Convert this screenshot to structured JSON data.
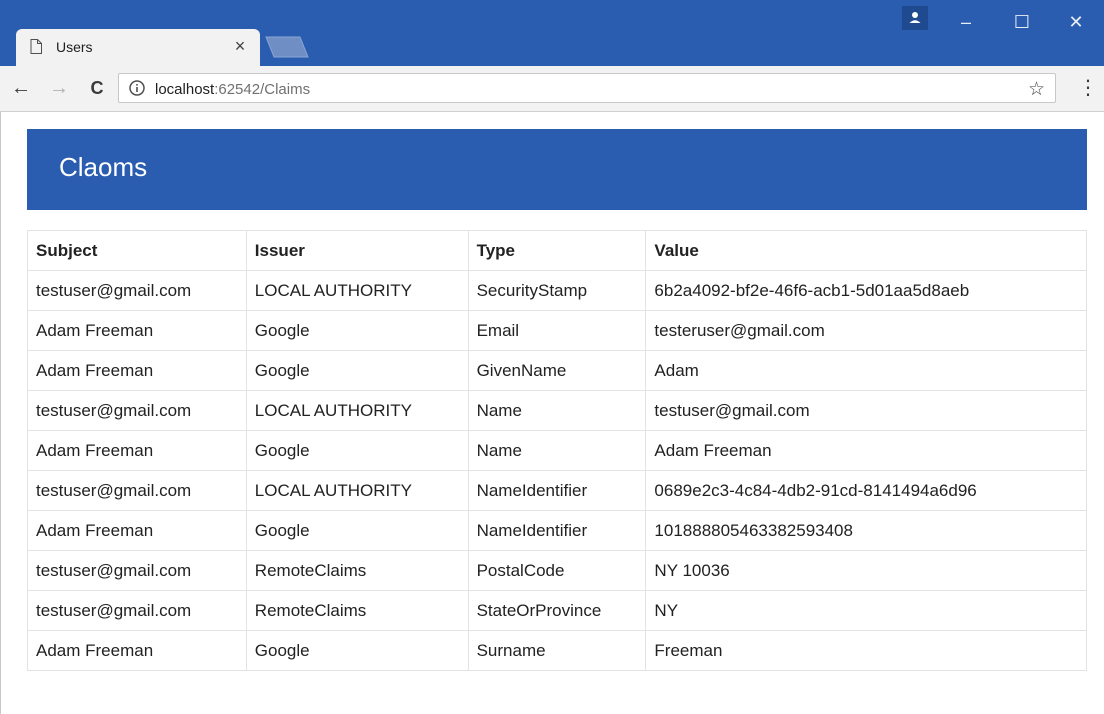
{
  "browser": {
    "tab_title": "Users",
    "tab_close": "×",
    "url_host": "localhost",
    "url_path": ":62542/Claims",
    "window_controls": {
      "minimize": "–",
      "maximize": "☐",
      "close": "✕"
    },
    "nav": {
      "back": "←",
      "forward": "→",
      "reload": "C"
    },
    "star": "☆",
    "menu": "⋮",
    "colors": {
      "chrome": "#2a5db0",
      "tab": "#f2f2f2"
    }
  },
  "page": {
    "title": "Claoms",
    "table": {
      "headers": [
        "Subject",
        "Issuer",
        "Type",
        "Value"
      ],
      "rows": [
        [
          "testuser@gmail.com",
          "LOCAL AUTHORITY",
          "SecurityStamp",
          "6b2a4092-bf2e-46f6-acb1-5d01aa5d8aeb"
        ],
        [
          "Adam Freeman",
          "Google",
          "Email",
          "testeruser@gmail.com"
        ],
        [
          "Adam Freeman",
          "Google",
          "GivenName",
          "Adam"
        ],
        [
          "testuser@gmail.com",
          "LOCAL AUTHORITY",
          "Name",
          "testuser@gmail.com"
        ],
        [
          "Adam Freeman",
          "Google",
          "Name",
          "Adam Freeman"
        ],
        [
          "testuser@gmail.com",
          "LOCAL AUTHORITY",
          "NameIdentifier",
          "0689e2c3-4c84-4db2-91cd-8141494a6d96"
        ],
        [
          "Adam Freeman",
          "Google",
          "NameIdentifier",
          "101888805463382593408"
        ],
        [
          "testuser@gmail.com",
          "RemoteClaims",
          "PostalCode",
          "NY 10036"
        ],
        [
          "testuser@gmail.com",
          "RemoteClaims",
          "StateOrProvince",
          "NY"
        ],
        [
          "Adam Freeman",
          "Google",
          "Surname",
          "Freeman"
        ]
      ]
    },
    "colors": {
      "banner": "#2a5db0",
      "banner_text": "#ffffff"
    }
  }
}
